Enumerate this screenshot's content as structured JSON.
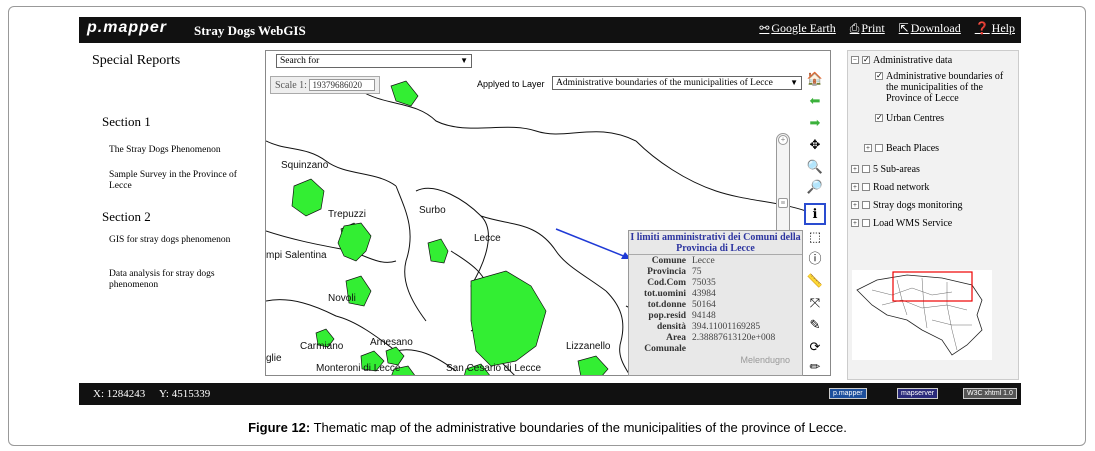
{
  "header": {
    "brand": "p.mapper",
    "title": "Stray Dogs WebGIS",
    "links": {
      "google_earth": "Google Earth",
      "print": "Print",
      "download": "Download",
      "help": "Help"
    }
  },
  "left_panel": {
    "title": "Special Reports",
    "section1": "Section 1",
    "item1": "The Stray Dogs Phenomenon",
    "item2": "Sample Survey in the Province of Lecce",
    "section2": "Section 2",
    "item3": "GIS for stray dogs phenomenon",
    "item4": "Data analysis for stray dogs phenomenon"
  },
  "map": {
    "search_placeholder": "Search for",
    "scale_label": "Scale 1:",
    "scale_value": "19379686020",
    "applied_label": "Applyed to Layer",
    "applied_layer": "Administrative boundaries of the municipalities of Lecce",
    "places": {
      "squinzano": "Squinzano",
      "trepuzzi": "Trepuzzi",
      "surbo": "Surbo",
      "lecce": "Lecce",
      "salentina": "mpi Salentina",
      "novoli": "Novoli",
      "carmiano": "Carmiano",
      "arnesano": "Arnesano",
      "monteroni": "Monteroni di Lecce",
      "sancesario": "San Cesario di Lecce",
      "lizzanello": "Lizzanello",
      "glie": "glie",
      "melendugno": "Melendugno"
    }
  },
  "popup": {
    "title": "I limiti amministrativi dei Comuni della Provincia di Lecce",
    "rows": [
      {
        "k": "Comune",
        "v": "Lecce"
      },
      {
        "k": "Provincia",
        "v": "75"
      },
      {
        "k": "Cod.Com",
        "v": "75035"
      },
      {
        "k": "tot.uomini",
        "v": "43984"
      },
      {
        "k": "tot.donne",
        "v": "50164"
      },
      {
        "k": "pop.resid",
        "v": "94148"
      },
      {
        "k": "densità",
        "v": "394.11001169285"
      },
      {
        "k": "Area",
        "v": "2.38887613120e+008"
      },
      {
        "k": "Comunale",
        "v": ""
      }
    ]
  },
  "toc": {
    "admin": "Administrative data",
    "admin_bounds": "Administrative boundaries of the municipalities of the Province of Lecce",
    "urban": "Urban Centres",
    "beach": "Beach Places",
    "subareas": "5 Sub-areas",
    "road": "Road network",
    "stray": "Stray dogs monitoring",
    "wms": "Load WMS Service"
  },
  "status": {
    "x": "X: 1284243",
    "y": "Y: 4515339",
    "badge1": "p.mapper",
    "badge2": "mapserver",
    "badge3": "W3C xhtml 1.0"
  },
  "caption": {
    "label": "Figure 12:",
    "text": " Thematic map of the administrative boundaries of the municipalities of the province of Lecce."
  },
  "colors": {
    "urban_fill": "#33ee33",
    "toolbar_active": "#2a4cd0",
    "popup_title": "#2d35a0"
  }
}
